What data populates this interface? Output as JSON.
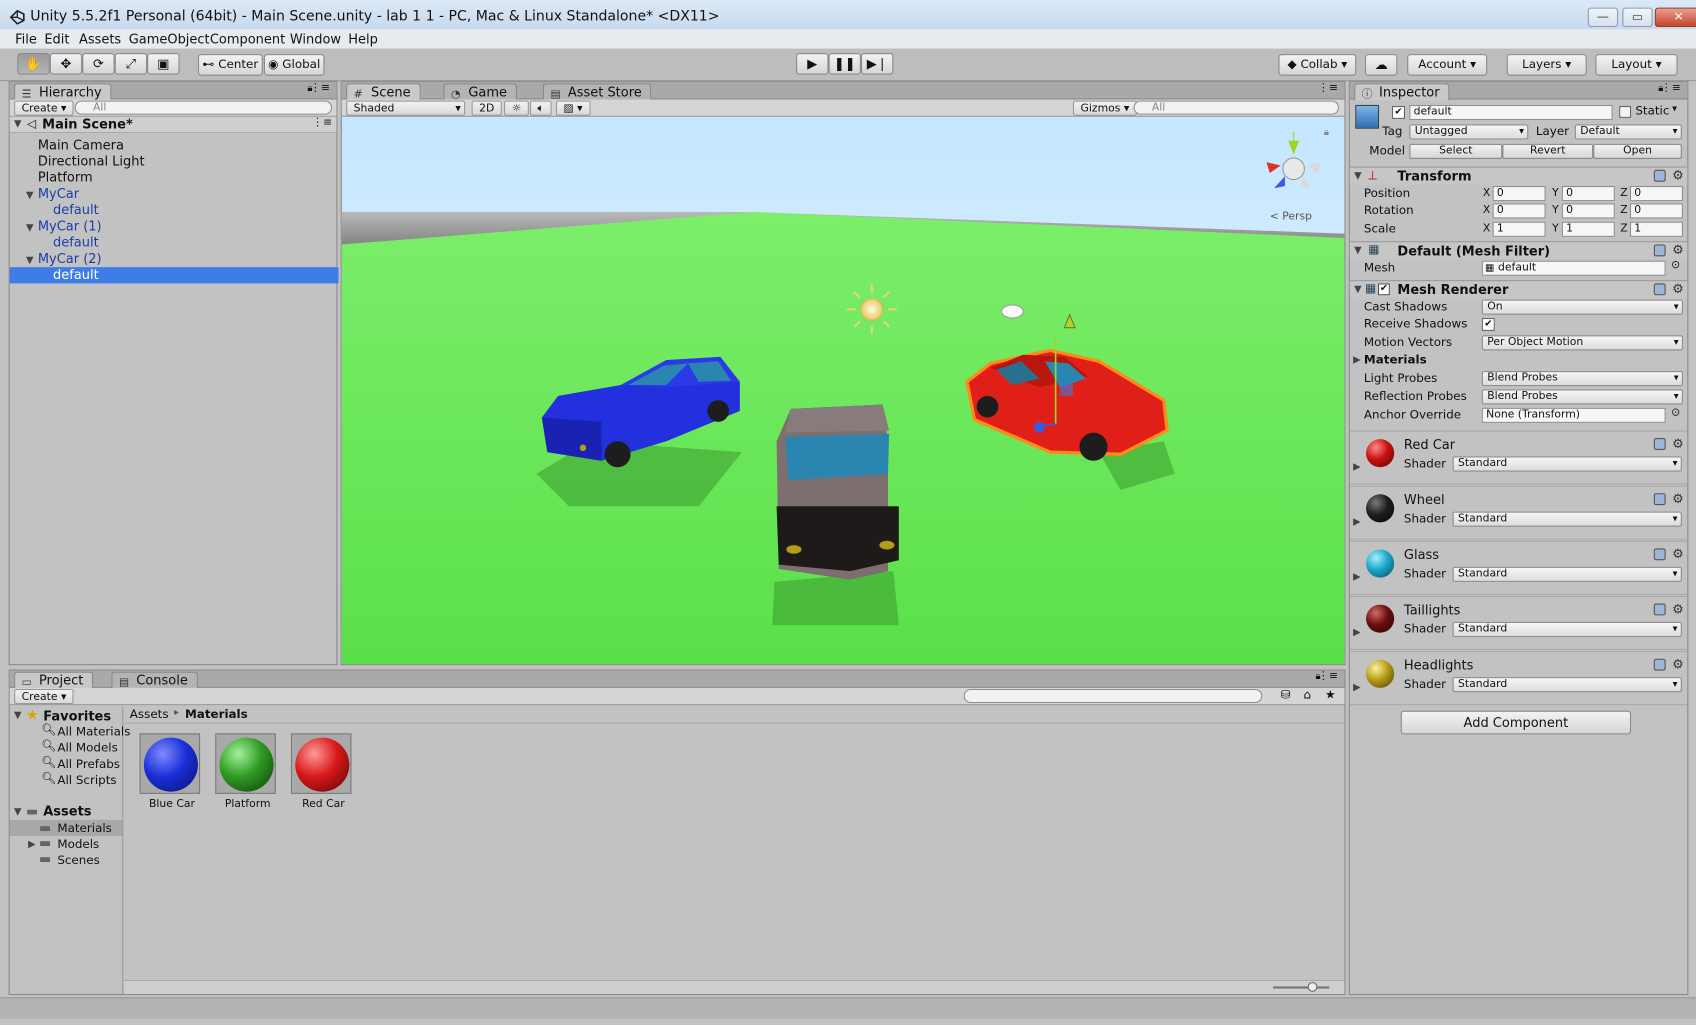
{
  "window": {
    "title": "Unity 5.5.2f1 Personal (64bit) - Main Scene.unity - lab 1 1 - PC, Mac & Linux Standalone* <DX11>",
    "minimize": "—",
    "maximize": "▭",
    "close": "✕"
  },
  "menu": [
    "File",
    "Edit",
    "Assets",
    "GameObject",
    "Component",
    "Window",
    "Help"
  ],
  "toolbar": {
    "pivot": "Center",
    "space": "Global",
    "collab": "Collab",
    "account": "Account",
    "layers": "Layers",
    "layout": "Layout"
  },
  "hierarchy": {
    "tab": "Hierarchy",
    "create": "Create",
    "search_placeholder": "All",
    "scene": "Main Scene*",
    "items": [
      {
        "label": "Main Camera"
      },
      {
        "label": "Directional Light"
      },
      {
        "label": "Platform"
      },
      {
        "label": "MyCar"
      },
      {
        "label": "default"
      },
      {
        "label": "MyCar (1)"
      },
      {
        "label": "default"
      },
      {
        "label": "MyCar (2)"
      },
      {
        "label": "default"
      }
    ]
  },
  "scene_view": {
    "tabs": [
      "Scene",
      "Game",
      "Asset Store"
    ],
    "shading": "Shaded",
    "mode_2d": "2D",
    "gizmos": "Gizmos",
    "search_placeholder": "All",
    "projection": "< Persp",
    "colors": {
      "ground": "#66e85a",
      "sky": "#dff2ff",
      "blue_car": "#2028d8",
      "red_car": "#e02018",
      "gray_car": "#7d6f6f"
    }
  },
  "project": {
    "tabs": [
      "Project",
      "Console"
    ],
    "create": "Create",
    "favorites_label": "Favorites",
    "favorites": [
      "All Materials",
      "All Models",
      "All Prefabs",
      "All Scripts"
    ],
    "assets_label": "Assets",
    "folders": [
      "Materials",
      "Models",
      "Scenes"
    ],
    "breadcrumb": [
      "Assets",
      "Materials"
    ],
    "assets": [
      {
        "name": "Blue Car",
        "color": "#1a2fd8"
      },
      {
        "name": "Platform",
        "color": "#2e9a22"
      },
      {
        "name": "Red Car",
        "color": "#d81818"
      }
    ]
  },
  "inspector": {
    "tab": "Inspector",
    "object_name": "default",
    "static_label": "Static",
    "tag_label": "Tag",
    "tag": "Untagged",
    "layer_label": "Layer",
    "layer": "Default",
    "model_label": "Model",
    "model_buttons": [
      "Select",
      "Revert",
      "Open"
    ],
    "transform": {
      "title": "Transform",
      "rows": [
        {
          "label": "Position",
          "x": "0",
          "y": "0",
          "z": "0"
        },
        {
          "label": "Rotation",
          "x": "0",
          "y": "0",
          "z": "0"
        },
        {
          "label": "Scale",
          "x": "1",
          "y": "1",
          "z": "1"
        }
      ]
    },
    "mesh_filter": {
      "title": "Default (Mesh Filter)",
      "mesh_label": "Mesh",
      "mesh": "default"
    },
    "mesh_renderer": {
      "title": "Mesh Renderer",
      "cast_shadows_label": "Cast Shadows",
      "cast_shadows": "On",
      "receive_shadows_label": "Receive Shadows",
      "motion_vectors_label": "Motion Vectors",
      "motion_vectors": "Per Object Motion",
      "materials_label": "Materials",
      "light_probes_label": "Light Probes",
      "light_probes": "Blend Probes",
      "reflection_probes_label": "Reflection Probes",
      "reflection_probes": "Blend Probes",
      "anchor_override_label": "Anchor Override",
      "anchor_override": "None (Transform)"
    },
    "materials": [
      {
        "name": "Red Car",
        "shader_label": "Shader",
        "shader": "Standard",
        "color": "#c81010"
      },
      {
        "name": "Wheel",
        "shader_label": "Shader",
        "shader": "Standard",
        "color": "#1d1d1d"
      },
      {
        "name": "Glass",
        "shader_label": "Shader",
        "shader": "Standard",
        "color": "#1aa6c8"
      },
      {
        "name": "Taillights",
        "shader_label": "Shader",
        "shader": "Standard",
        "color": "#6a0e0e"
      },
      {
        "name": "Headlights",
        "shader_label": "Shader",
        "shader": "Standard",
        "color": "#b49c16"
      }
    ],
    "add_component": "Add Component"
  }
}
